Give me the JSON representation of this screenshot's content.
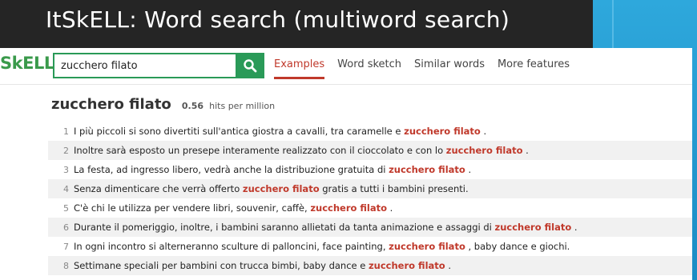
{
  "slide": {
    "title": "ItSkELL: Word search (multiword search)"
  },
  "app": {
    "logo": {
      "part1": "SkE",
      "part2": "LL"
    },
    "search": {
      "value": "zucchero filato",
      "button_icon": "search-icon"
    },
    "nav": [
      {
        "label": "Examples",
        "active": true
      },
      {
        "label": "Word sketch",
        "active": false
      },
      {
        "label": "Similar words",
        "active": false
      },
      {
        "label": "More features",
        "active": false
      }
    ],
    "result_heading": {
      "term": "zucchero filato",
      "hits_value": "0.56",
      "hits_unit": "hits per million"
    },
    "results": [
      {
        "num": "1",
        "before": "I più piccoli si sono divertiti sull'antica giostra a cavalli, tra caramelle e ",
        "kw": "zucchero filato",
        "after": " ."
      },
      {
        "num": "2",
        "before": "Inoltre sarà esposto un presepe interamente realizzato con il cioccolato e con lo ",
        "kw": "zucchero filato",
        "after": " ."
      },
      {
        "num": "3",
        "before": "La festa, ad ingresso libero, vedrà anche la distribuzione gratuita di ",
        "kw": "zucchero filato",
        "after": " ."
      },
      {
        "num": "4",
        "before": "Senza dimenticare che verrà offerto ",
        "kw": "zucchero filato",
        "after": " gratis a tutti i bambini presenti."
      },
      {
        "num": "5",
        "before": "C'è chi le utilizza per vendere libri, souvenir, caffè, ",
        "kw": "zucchero filato",
        "after": " ."
      },
      {
        "num": "6",
        "before": "Durante il pomeriggio, inoltre, i bambini saranno allietati da tanta animazione e assaggi di ",
        "kw": "zucchero filato",
        "after": " ."
      },
      {
        "num": "7",
        "before": "In ogni incontro si alterneranno sculture di palloncini, face painting, ",
        "kw": "zucchero filato",
        "after": " , baby dance e giochi."
      },
      {
        "num": "8",
        "before": "Settimane speciali per bambini con trucca bimbi, baby dance e ",
        "kw": "zucchero filato",
        "after": " ."
      }
    ]
  },
  "colors": {
    "accent_green": "#2a9a58",
    "keyword_red": "#c0392b",
    "slide_blue": "#2ea8dc"
  }
}
